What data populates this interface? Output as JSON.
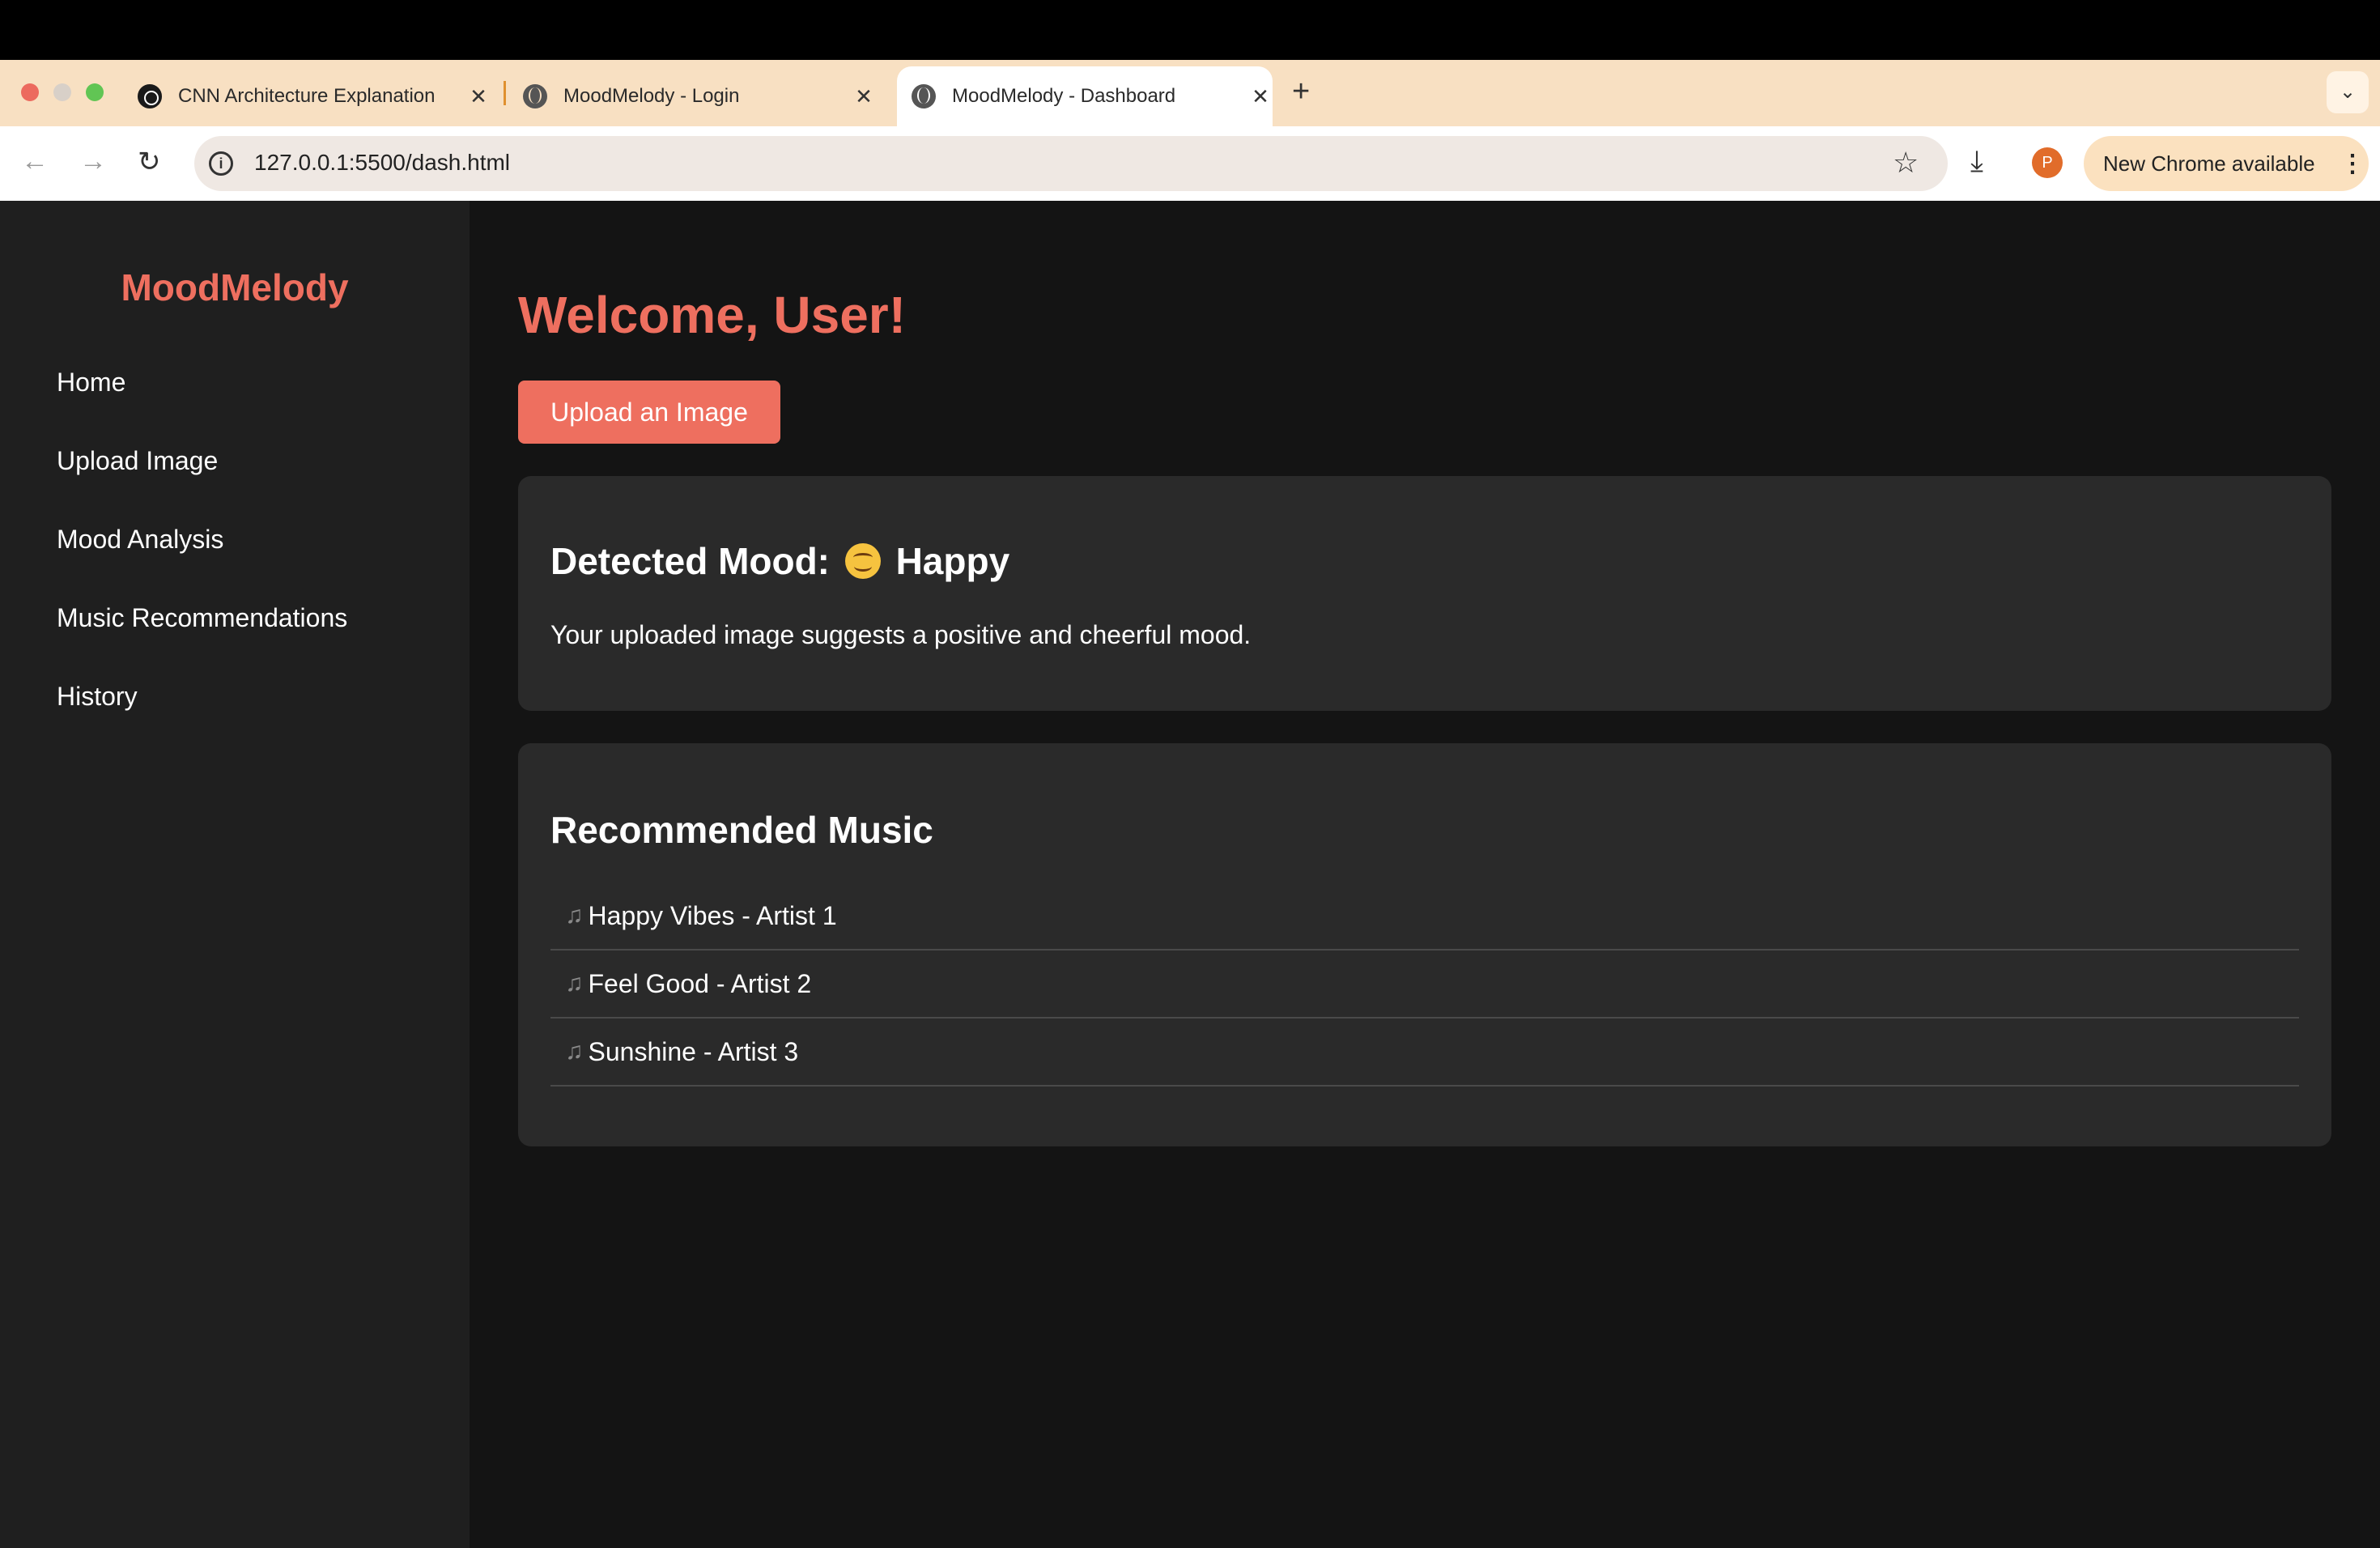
{
  "browser": {
    "tabs": [
      {
        "title": "CNN Architecture Explanation",
        "favicon": "openai-icon"
      },
      {
        "title": "MoodMelody - Login",
        "favicon": "globe-icon"
      },
      {
        "title": "MoodMelody - Dashboard",
        "favicon": "globe-icon",
        "active": true
      }
    ],
    "close_glyph": "✕",
    "new_tab_glyph": "+",
    "tab_menu_glyph": "⌄",
    "url": "127.0.0.1:5500/dash.html",
    "profile_initial": "P",
    "update_label": "New Chrome available",
    "update_menu_glyph": "⋮"
  },
  "sidebar": {
    "brand": "MoodMelody",
    "items": [
      {
        "label": "Home"
      },
      {
        "label": "Upload Image"
      },
      {
        "label": "Mood Analysis"
      },
      {
        "label": "Music Recommendations"
      },
      {
        "label": "History"
      }
    ]
  },
  "main": {
    "welcome": "Welcome, User!",
    "upload_button": "Upload an Image",
    "mood": {
      "heading_prefix": "Detected Mood:",
      "emoji": "smiling-face-icon",
      "mood_label": "Happy",
      "description": "Your uploaded image suggests a positive and cheerful mood."
    },
    "music": {
      "heading": "Recommended Music",
      "note_glyph": "♫",
      "songs": [
        {
          "label": "Happy Vibes - Artist 1"
        },
        {
          "label": "Feel Good - Artist 2"
        },
        {
          "label": "Sunshine - Artist 3"
        }
      ]
    }
  },
  "colors": {
    "accent": "#ee6f5f",
    "background": "#141414",
    "sidebar": "#1f1f1f",
    "card": "#2a2a2a",
    "tabstrip": "#f8e0c2"
  }
}
